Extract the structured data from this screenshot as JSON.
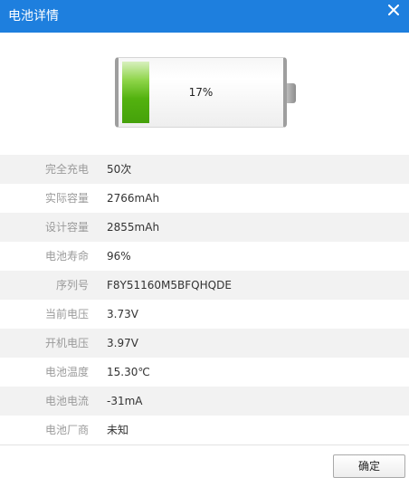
{
  "window": {
    "title": "电池详情",
    "close_icon": "close-icon"
  },
  "battery": {
    "percent_label": "17%",
    "level_fraction": 0.17,
    "fill_color": "#53b20f"
  },
  "details": [
    {
      "label": "完全充电",
      "value": "50次"
    },
    {
      "label": "实际容量",
      "value": "2766mAh"
    },
    {
      "label": "设计容量",
      "value": "2855mAh"
    },
    {
      "label": "电池寿命",
      "value": "96%"
    },
    {
      "label": "序列号",
      "value": "F8Y51160M5BFQHQDE"
    },
    {
      "label": "当前电压",
      "value": "3.73V"
    },
    {
      "label": "开机电压",
      "value": "3.97V"
    },
    {
      "label": "电池温度",
      "value": "15.30℃"
    },
    {
      "label": "电池电流",
      "value": "-31mA"
    },
    {
      "label": "电池厂商",
      "value": "未知"
    }
  ],
  "footer": {
    "ok_label": "确定"
  },
  "colors": {
    "titlebar": "#1e7fde",
    "row_alt": "#f2f2f2",
    "label_text": "#9a9a9a"
  }
}
